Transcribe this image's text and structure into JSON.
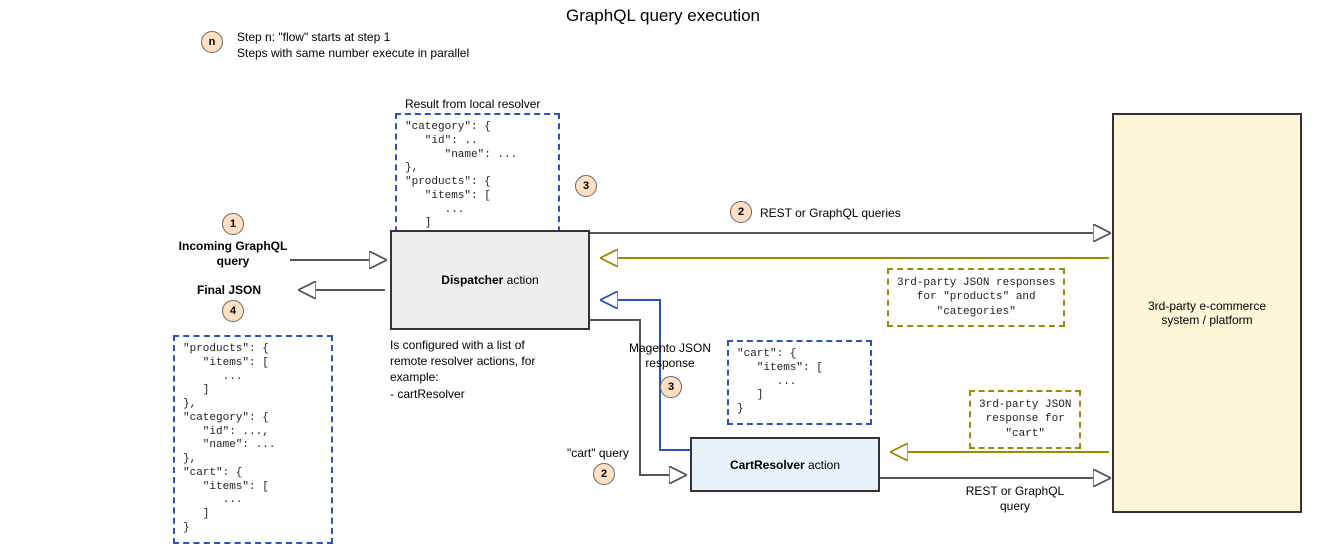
{
  "title": "GraphQL query execution",
  "legend": {
    "badge": "n",
    "line1": "Step n: \"flow\" starts at step 1",
    "line2": "Steps with same number execute in parallel"
  },
  "steps": {
    "incoming": "1",
    "cartQuery": "2",
    "restTop": "2",
    "magentoResp": "3",
    "localResolver": "3",
    "final": "4"
  },
  "labels": {
    "incoming": "Incoming GraphQL\nquery",
    "finalJson": "Final JSON",
    "localResolverHdr": "Result from local resolver",
    "restTop": "REST or GraphQL queries",
    "restBottom": "REST or GraphQL\nquery",
    "magento": "Magento\nJSON response",
    "cartQuery": "\"cart\" query"
  },
  "boxes": {
    "dispatcher_strong": "Dispatcher",
    "dispatcher_rest": " action",
    "cartresolver_strong": "CartResolver",
    "cartresolver_rest": " action",
    "ecom": "3rd-party e-commerce\nsystem / platform"
  },
  "json": {
    "localResolver": "\"category\": {\n   \"id\": ..\n      \"name\": ...\n},\n\"products\": {\n   \"items\": [\n      ...\n   ]\n}",
    "cartResp": "\"cart\": {\n   \"items\": [\n      ...\n   ]\n}",
    "finalJson": "\"products\": {\n   \"items\": [\n      ...\n   ]\n},\n\"category\": {\n   \"id\": ...,\n   \"name\": ...\n},\n\"cart\": {\n   \"items\": [\n      ...\n   ]\n}"
  },
  "responses": {
    "top": "3rd-party JSON responses\nfor \"products\" and\n\"categories\"",
    "bottom": "3rd-party JSON\nresponse for\n\"cart\""
  },
  "dispatcherNote": "Is configured with a list of\nremote resolver actions, for\nexample:\n- cartResolver"
}
